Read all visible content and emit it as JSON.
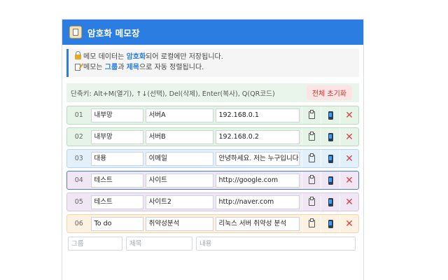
{
  "app": {
    "title": "암호화 메모장",
    "icon": "notepad-icon"
  },
  "info": {
    "line1": {
      "pre": "메모 데이터는 ",
      "highlight": "암호화",
      "post": "되어 로컬에만 저장됩니다."
    },
    "line2": {
      "pre": "메모는 ",
      "hl1": "그룹",
      "mid": "과 ",
      "hl2": "제목",
      "post": "으로 자동 정렬됩니다."
    }
  },
  "shortcuts": {
    "text": "단축키: Alt+M(열기), ↑↓(선택), Del(삭제), Enter(복사), Q(QR코드)",
    "reset_label": "전체 초기화"
  },
  "memos": [
    {
      "num": "01",
      "group": "내부망",
      "title": "서버A",
      "content": "192.168.0.1",
      "bg": "#e6f4e7",
      "border": "#b9dcbc"
    },
    {
      "num": "02",
      "group": "내부망",
      "title": "서버B",
      "content": "192.168.0.2",
      "bg": "#e6f4e7",
      "border": "#b9dcbc"
    },
    {
      "num": "03",
      "group": "대용",
      "title": "이메일",
      "content": "안녕하세요. 저는 누구입니다",
      "bg": "#e2f0fb",
      "border": "#b5d6f1"
    },
    {
      "num": "04",
      "group": "테스트",
      "title": "사이트",
      "content": "http://google.com",
      "bg": "#f1e6f4",
      "border": "#4a7fd0"
    },
    {
      "num": "05",
      "group": "테스트",
      "title": "사이트2",
      "content": "http://naver.com",
      "bg": "#f1e6f4",
      "border": "#dbc2e3"
    },
    {
      "num": "06",
      "group": "To do",
      "title": "취약성분석",
      "content": "리눅스 서버 취약성 분석",
      "bg": "#fdf1e2",
      "border": "#f2d5ac"
    }
  ],
  "new_memo": {
    "group_placeholder": "그룹",
    "title_placeholder": "제목",
    "content_placeholder": "내용"
  },
  "colors": {
    "accent": "#2b7de1",
    "danger": "#d74343"
  }
}
